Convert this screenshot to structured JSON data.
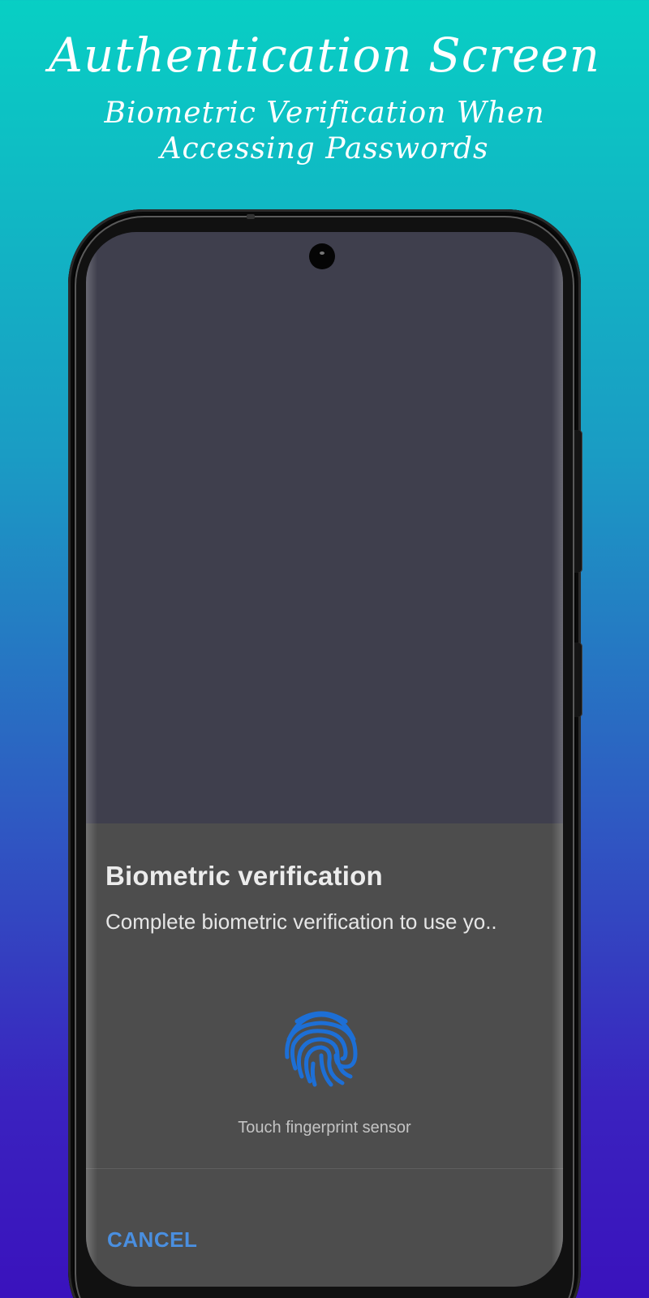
{
  "header": {
    "title": "Authentication Screen",
    "subtitle": "Biometric Verification When Accessing Passwords"
  },
  "dialog": {
    "title": "Biometric verification",
    "description": "Complete biometric verification to use yo..",
    "fingerprint_icon": "fingerprint-icon",
    "hint": "Touch fingerprint sensor",
    "cancel_label": "CANCEL"
  },
  "colors": {
    "gradient_top": "#08cfc4",
    "gradient_bottom": "#3a12bd",
    "screen_background": "#3f3f4d",
    "sheet_background": "#4d4d4d",
    "accent": "#4a8fe0",
    "fingerprint": "#1d6fd6"
  }
}
